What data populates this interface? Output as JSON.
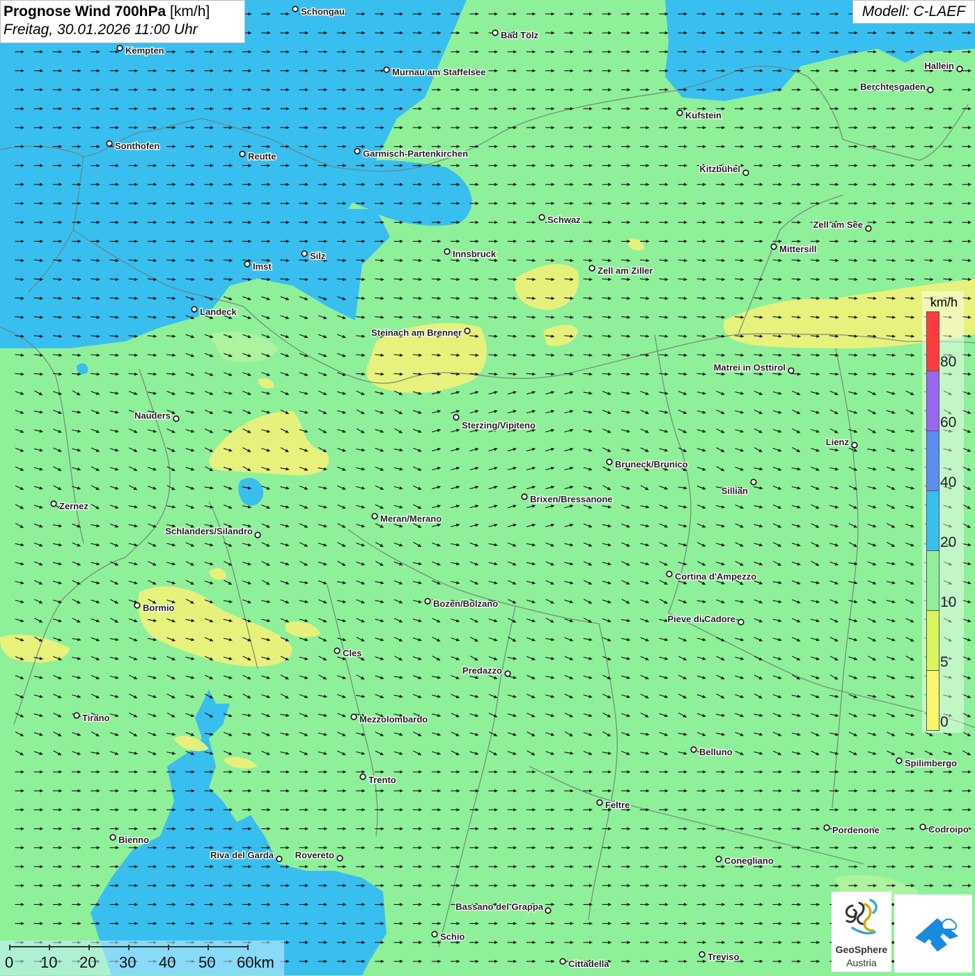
{
  "header": {
    "title_bold": "Prognose Wind 700hPa",
    "title_unit": "[km/h]",
    "subtitle": "Freitag, 30.01.2026 11:00 Uhr",
    "model": "Modell: C-LAEF"
  },
  "legend": {
    "unit": "km/h",
    "ticks": [
      "80",
      "60",
      "40",
      "20",
      "10",
      "5",
      "0"
    ],
    "colors": [
      "#ff3b3b",
      "#9a66f0",
      "#5b8df0",
      "#38bff0",
      "#8ff09a",
      "#d8f55a",
      "#fbf56a"
    ]
  },
  "scale_bar": {
    "labels": [
      "0",
      "10",
      "20",
      "30",
      "40",
      "50",
      "60km"
    ]
  },
  "logo": {
    "name_line1": "GeoSphere",
    "name_line2": "Austria"
  },
  "colors": {
    "wind_10_20": "#8ff09a",
    "wind_20_40": "#38bff0",
    "wind_5_10": "#eef27a",
    "border": "#6f7f77",
    "arrow": "#111111"
  },
  "wind": {
    "prevailing_direction": "west to east"
  },
  "cities": [
    {
      "name": "Schongau"
    },
    {
      "name": "Bad Tölz"
    },
    {
      "name": "Kempten"
    },
    {
      "name": "Murnau am Staffelsee"
    },
    {
      "name": "Hallein"
    },
    {
      "name": "Berchtesgaden"
    },
    {
      "name": "Kufstein"
    },
    {
      "name": "Sonthofen"
    },
    {
      "name": "Reutte"
    },
    {
      "name": "Garmisch-Partenkirchen"
    },
    {
      "name": "Kitzbühel"
    },
    {
      "name": "Schwaz"
    },
    {
      "name": "Zell am See"
    },
    {
      "name": "Innsbruck"
    },
    {
      "name": "Silz"
    },
    {
      "name": "Mittersill"
    },
    {
      "name": "Imst"
    },
    {
      "name": "Zell am Ziller"
    },
    {
      "name": "Landeck"
    },
    {
      "name": "Steinach am Brenner"
    },
    {
      "name": "Matrei in Osttirol"
    },
    {
      "name": "Nauders"
    },
    {
      "name": "Sterzing/Vipiteno"
    },
    {
      "name": "Lienz"
    },
    {
      "name": "Bruneck/Brunico"
    },
    {
      "name": "Sillian"
    },
    {
      "name": "Zernez"
    },
    {
      "name": "Brixen/Bressanone"
    },
    {
      "name": "Meran/Merano"
    },
    {
      "name": "Schlanders/Silandro"
    },
    {
      "name": "Cortina d'Ampezzo"
    },
    {
      "name": "Bozen/Bolzano"
    },
    {
      "name": "Bormio"
    },
    {
      "name": "Pieve di Cadore"
    },
    {
      "name": "Cles"
    },
    {
      "name": "Predazzo"
    },
    {
      "name": "Tirano"
    },
    {
      "name": "Mezzolombardo"
    },
    {
      "name": "Belluno"
    },
    {
      "name": "Spilimbergo"
    },
    {
      "name": "Trento"
    },
    {
      "name": "Feltre"
    },
    {
      "name": "Pordenone"
    },
    {
      "name": "Codroipo"
    },
    {
      "name": "Bienno"
    },
    {
      "name": "Riva del Garda"
    },
    {
      "name": "Rovereto"
    },
    {
      "name": "Conegliano"
    },
    {
      "name": "Bassano del Grappa"
    },
    {
      "name": "Schio"
    },
    {
      "name": "Treviso"
    },
    {
      "name": "Cittadella"
    }
  ]
}
